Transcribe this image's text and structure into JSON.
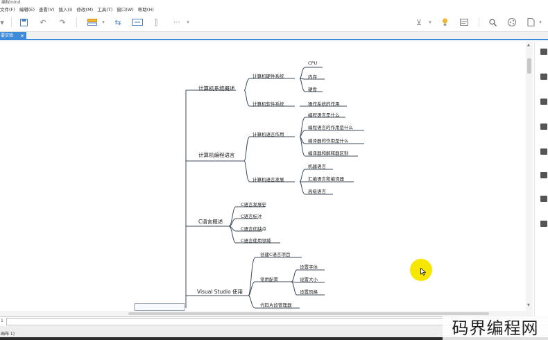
{
  "window": {
    "title": "编程mind"
  },
  "menu": {
    "items": [
      "文件(F)",
      "编辑(E)",
      "查看(V)",
      "插入(I)",
      "修改(M)",
      "工具(T)",
      "窗口(W)",
      "帮助(H)"
    ]
  },
  "tab": {
    "label": "要实验",
    "close": "✕"
  },
  "mindmap": {
    "l1": [
      "计算机系统概述",
      "计算机编程语言",
      "C语言概述",
      "Visual Studio 使用"
    ],
    "l2": [
      "计算机硬件系统",
      "计算机软件系统",
      "计算机语言作用",
      "计算机语言发展",
      "C语言发展史",
      "C语言标注",
      "C语言优缺点",
      "C语言使用领域",
      "创建C语言项目",
      "常用配置",
      "代码片段管理器"
    ],
    "l3": [
      "CPU",
      "内存",
      "硬盘",
      "操作系统的作用",
      "编程语言是什么",
      "编程语言的作用是什么",
      "编译器的作用是什么",
      "编译器和解释器区别",
      "机器语言",
      "汇编语言和编译器",
      "高级语言",
      "设置字体",
      "设置大小",
      "设置风格"
    ]
  },
  "findbar": {
    "line": "1"
  },
  "status": {
    "text": "画布 1)"
  },
  "watermark": "码界编程网",
  "colors": {
    "accent": "#3c8ad8",
    "branch": "#3b4a5a",
    "cursor": "#f7e600"
  }
}
